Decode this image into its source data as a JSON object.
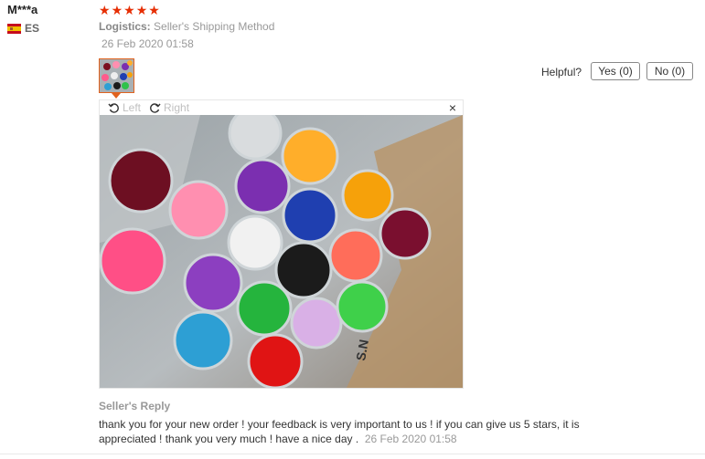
{
  "review": {
    "user_name": "M***a",
    "country_code": "ES",
    "rating": 5,
    "logistics_label": "Logistics:",
    "logistics_value": "Seller's Shipping Method",
    "date": "26 Feb 2020 01:58"
  },
  "helpful": {
    "label": "Helpful?",
    "yes_label": "Yes (0)",
    "no_label": "No (0)"
  },
  "viewer": {
    "rotate_left_label": "Left",
    "rotate_right_label": "Right",
    "close_glyph": "×"
  },
  "seller_reply": {
    "title": "Seller's Reply",
    "text": "thank you for your new order ! your feedback is very important to us ! if you can give us 5 stars, it is appreciated ! thank you very much ! have a nice day .",
    "date": "26 Feb 2020 01:58"
  },
  "colors": {
    "star": "#e62e04",
    "accent_border": "#e0621e",
    "muted_text": "#999999"
  }
}
